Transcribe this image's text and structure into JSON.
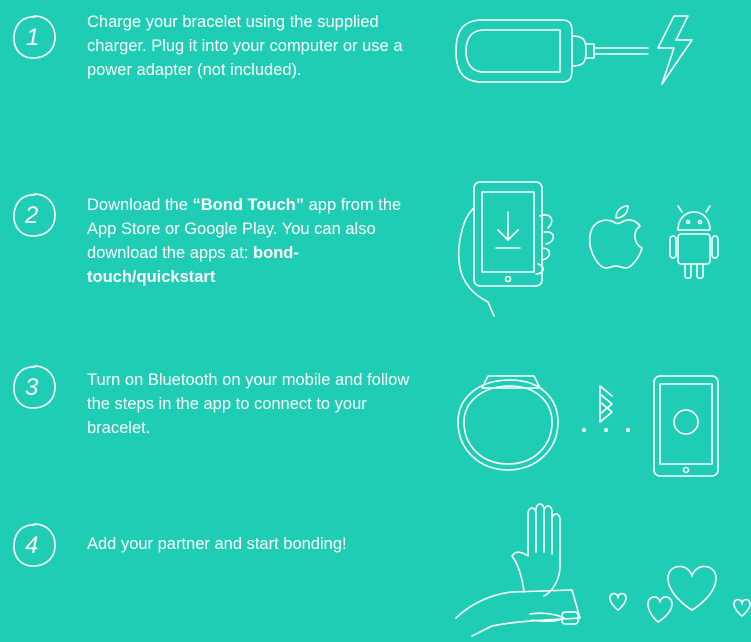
{
  "steps": [
    {
      "number": "1",
      "text": "Charge your bracelet using the supplied charger. Plug it into your computer or use a power adapter (not included).",
      "illustration_icons": [
        "charger-plug-icon",
        "lightning-bolt-icon"
      ]
    },
    {
      "number": "2",
      "text_prefix": "Download the ",
      "app_name": "“Bond Touch”",
      "text_middle": " app from the App Store or Google Play. You can also download the apps at: ",
      "link": "bond-touch/quickstart",
      "illustration_icons": [
        "phone-download-icon",
        "apple-icon",
        "android-icon"
      ]
    },
    {
      "number": "3",
      "text": "Turn on Bluetooth on your mobile and follow the steps in the app to connect to your bracelet.",
      "illustration_icons": [
        "bracelet-icon",
        "bluetooth-icon",
        "tablet-icon"
      ]
    },
    {
      "number": "4",
      "text": "Add your partner and start bonding!",
      "illustration_icons": [
        "hand-wrist-icon",
        "heart-icon"
      ]
    }
  ],
  "colors": {
    "background": "#1fcdb4",
    "foreground": "#ffffff"
  }
}
